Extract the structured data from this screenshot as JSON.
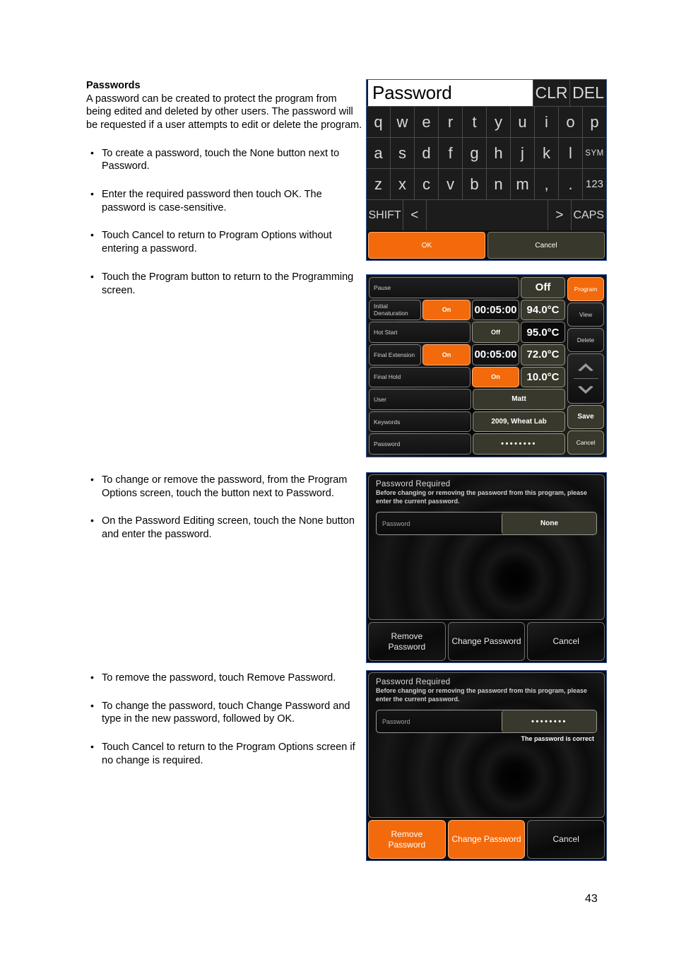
{
  "doc": {
    "heading": "Passwords",
    "intro": "A password can be created to protect the program from being edited and deleted by other users. The password will be requested if a user attempts to edit or delete the program.",
    "bullets_1": [
      "To create a password, touch the None button next to Password.",
      "Enter the required password then touch OK. The password is case-sensitive.",
      "Touch Cancel to return to Program Options without entering a password.",
      "Touch the Program button to return to the Programming screen."
    ],
    "bullets_2": [
      "To change or remove the password, from the Program Options screen, touch the button next to Password.",
      "On the Password Editing screen, touch the None button and enter the password."
    ],
    "bullets_3": [
      "To remove the password, touch Remove Password.",
      "To change the password, touch Change Password and type in the new password, followed by OK.",
      "Touch Cancel to return to the Program Options screen if no change is required."
    ],
    "page_number": "43"
  },
  "keyboard": {
    "entry_text": "Password",
    "clr_label": "CLR",
    "del_label": "DEL",
    "row1": [
      "q",
      "w",
      "e",
      "r",
      "t",
      "y",
      "u",
      "i",
      "o",
      "p"
    ],
    "row2": [
      "a",
      "s",
      "d",
      "f",
      "g",
      "h",
      "j",
      "k",
      "l"
    ],
    "row2_special": "SYM",
    "row3": [
      "z",
      "x",
      "c",
      "v",
      "b",
      "n",
      "m",
      ",",
      "."
    ],
    "row3_special": "123",
    "shift_label": "SHIFT",
    "left_arrow": "<",
    "right_arrow": ">",
    "caps_label": "CAPS",
    "space_label": "",
    "ok_label": "OK",
    "cancel_label": "Cancel",
    "accent": "#f26a0c",
    "olive": "#39382c"
  },
  "program_options": {
    "rows": [
      {
        "label": "Pause",
        "state": "Off",
        "time": "",
        "temp": ""
      },
      {
        "label": "Initial Denaturation",
        "state": "On",
        "time": "00:05:00",
        "temp": "94.0°C"
      },
      {
        "label": "Hot Start",
        "state": "Off",
        "time": "",
        "temp": "95.0°C"
      },
      {
        "label": "Final Extension",
        "state": "On",
        "time": "00:05:00",
        "temp": "72.0°C"
      },
      {
        "label": "Final Hold",
        "state": "On",
        "time": "",
        "temp": "10.0°C"
      }
    ],
    "info_rows": [
      {
        "label": "User",
        "value": "Matt"
      },
      {
        "label": "Keywords",
        "value": "2009, Wheat Lab"
      },
      {
        "label": "Password",
        "value": "••••••••"
      }
    ],
    "side_buttons": {
      "program": "Program",
      "view": "View",
      "delete": "Delete",
      "scroll_up": "▲",
      "scroll_down": "▼",
      "save": "Save",
      "cancel": "Cancel"
    }
  },
  "dialog_none": {
    "title": "Password Required",
    "subtitle": "Before changing or removing the password from this program, please enter the current password.",
    "field_label": "Password",
    "field_value": "None",
    "note": "",
    "buttons": {
      "remove": "Remove\nPassword",
      "remove_line1": "Remove",
      "remove_line2": "Password",
      "change": "Change Password",
      "cancel": "Cancel"
    }
  },
  "dialog_entered": {
    "title": "Password Required",
    "subtitle": "Before changing or removing the password from this program, please enter the current password.",
    "field_label": "Password",
    "field_value": "••••••••",
    "note": "The password is correct",
    "buttons": {
      "remove_line1": "Remove",
      "remove_line2": "Password",
      "change": "Change Password",
      "cancel": "Cancel"
    }
  }
}
